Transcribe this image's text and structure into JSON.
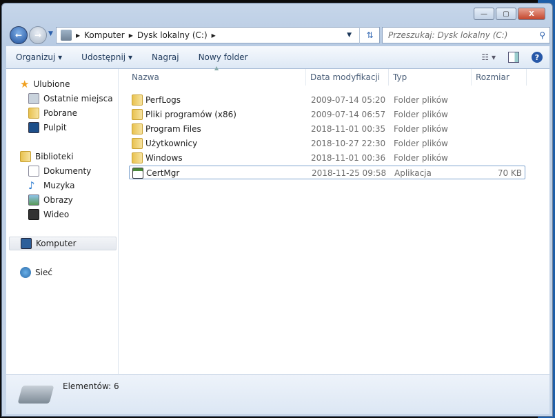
{
  "window": {
    "minimize": "—",
    "maximize": "▢",
    "close": "X"
  },
  "address": {
    "crumbs": [
      "Komputer",
      "Dysk lokalny (C:)"
    ]
  },
  "search": {
    "placeholder": "Przeszukaj: Dysk lokalny (C:)"
  },
  "toolbar": {
    "organize": "Organizuj",
    "share": "Udostępnij",
    "burn": "Nagraj",
    "new_folder": "Nowy folder"
  },
  "sidebar": {
    "favorites": {
      "label": "Ulubione",
      "items": [
        "Ostatnie miejsca",
        "Pobrane",
        "Pulpit"
      ]
    },
    "libraries": {
      "label": "Biblioteki",
      "items": [
        "Dokumenty",
        "Muzyka",
        "Obrazy",
        "Wideo"
      ]
    },
    "computer": "Komputer",
    "network": "Sieć"
  },
  "columns": [
    "Nazwa",
    "Data modyfikacji",
    "Typ",
    "Rozmiar"
  ],
  "files": [
    {
      "name": "PerfLogs",
      "date": "2009-07-14 05:20",
      "type": "Folder plików",
      "size": ""
    },
    {
      "name": "Pliki programów (x86)",
      "date": "2009-07-14 06:57",
      "type": "Folder plików",
      "size": ""
    },
    {
      "name": "Program Files",
      "date": "2018-11-01 00:35",
      "type": "Folder plików",
      "size": ""
    },
    {
      "name": "Użytkownicy",
      "date": "2018-10-27 22:30",
      "type": "Folder plików",
      "size": ""
    },
    {
      "name": "Windows",
      "date": "2018-11-01 00:36",
      "type": "Folder plików",
      "size": ""
    },
    {
      "name": "CertMgr",
      "date": "2018-11-25 09:58",
      "type": "Aplikacja",
      "size": "70 KB"
    }
  ],
  "status": {
    "count": "Elementów: 6"
  }
}
